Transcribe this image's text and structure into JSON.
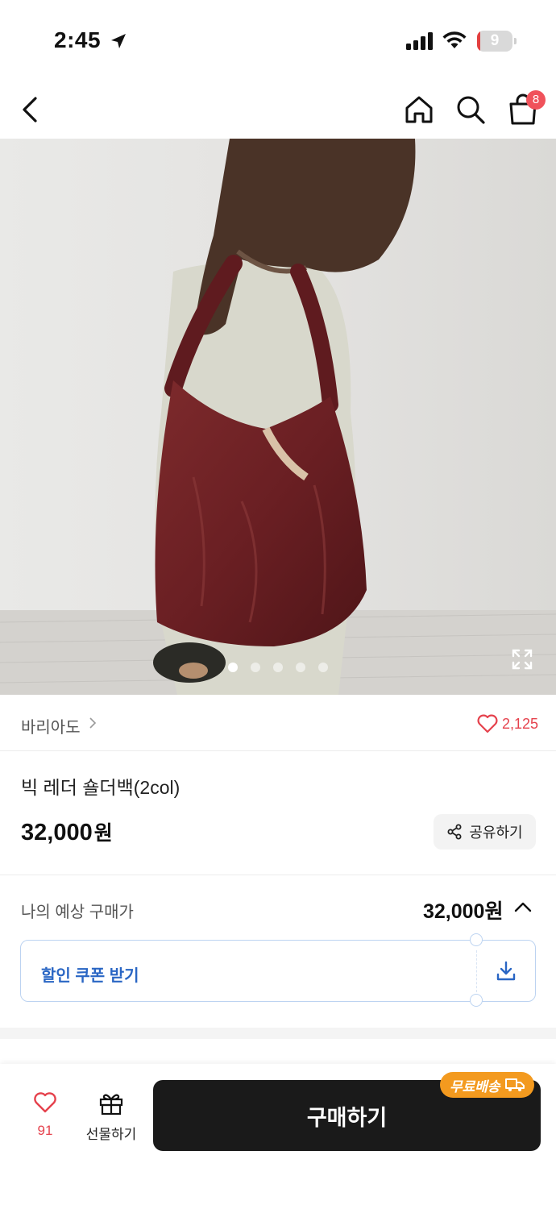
{
  "status_bar": {
    "time": "2:45",
    "battery_level": "9",
    "battery_fraction": 0.09
  },
  "nav": {
    "cart_count": "8"
  },
  "gallery": {
    "image_count": 5,
    "active_index": 0
  },
  "brand": {
    "name": "바리아도",
    "like_count": "2,125"
  },
  "product": {
    "title": "빅 레더 숄더백(2col)",
    "price": "32,000",
    "price_unit": "원",
    "share_label": "공유하기"
  },
  "expected": {
    "label": "나의 예상 구매가",
    "price": "32,000원"
  },
  "coupon": {
    "label": "할인 쿠폰 받기"
  },
  "bottom_bar": {
    "like_count": "91",
    "gift_label": "선물하기",
    "buy_label": "구매하기",
    "free_shipping_label": "무료배송"
  },
  "colors": {
    "accent_red": "#e5424d",
    "coupon_blue": "#2a66c4",
    "free_ship_orange": "#f39a1f",
    "buy_button": "#1a1a1a"
  }
}
